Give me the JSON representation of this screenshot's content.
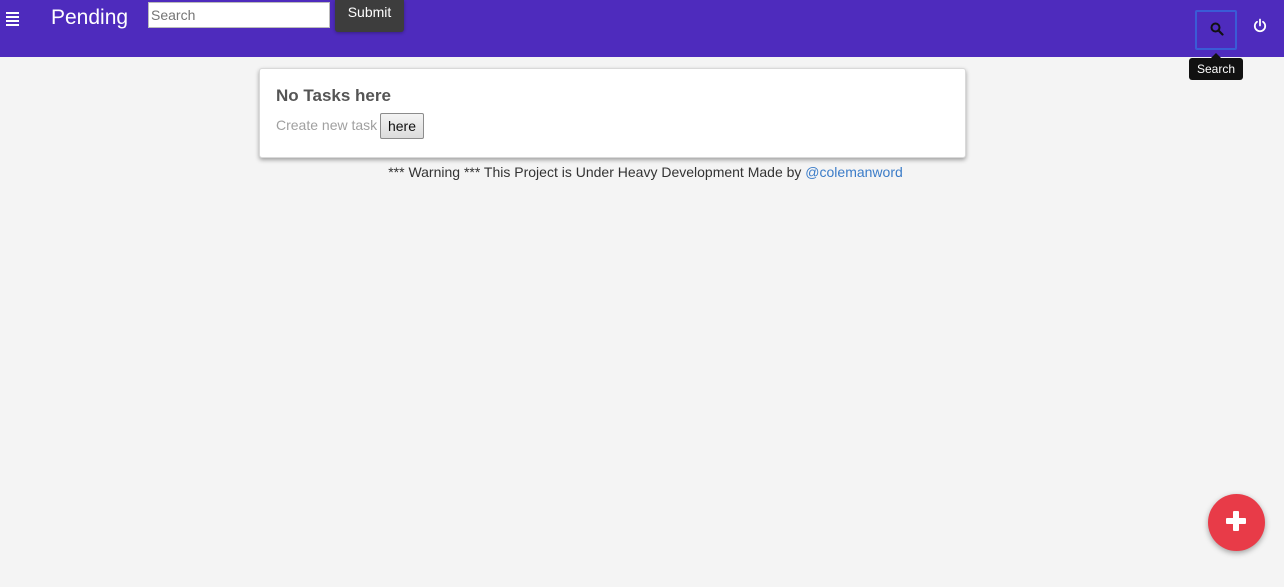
{
  "navbar": {
    "title": "Pending",
    "search_placeholder": "Search",
    "submit_label": "Submit",
    "menu_icon": "hamburger-menu-icon",
    "search_icon": "search-icon",
    "power_icon": "power-icon",
    "background_color": "#4e2bbd"
  },
  "tooltip": {
    "text": "Search"
  },
  "card": {
    "title": "No Tasks here",
    "text": "Create new task",
    "button_label": "here"
  },
  "footer": {
    "text": "*** Warning *** This Project is Under Heavy Development Made by",
    "link_text": "@colemanword"
  },
  "fab": {
    "icon": "plus-icon",
    "color": "#e83b48"
  }
}
